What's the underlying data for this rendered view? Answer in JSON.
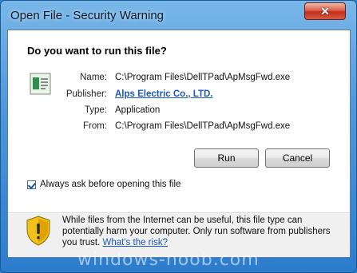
{
  "window": {
    "title": "Open File - Security Warning",
    "close_glyph": "✕"
  },
  "dialog": {
    "heading": "Do you want to run this file?",
    "fields": [
      {
        "label": "Name:",
        "value": "C:\\Program Files\\DellTPad\\ApMsgFwd.exe"
      },
      {
        "label": "Publisher:",
        "value": "Alps Electric Co., LTD."
      },
      {
        "label": "Type:",
        "value": "Application"
      },
      {
        "label": "From:",
        "value": "C:\\Program Files\\DellTPad\\ApMsgFwd.exe"
      }
    ],
    "run_label": "Run",
    "cancel_label": "Cancel",
    "checkbox_label": "Always ask before opening this file",
    "checkbox_checked": true,
    "warning_text": "While files from the Internet can be useful, this file type can potentially harm your computer. Only run software from publishers you trust.",
    "warning_link": "What's the risk?"
  },
  "icons": {
    "file": "application-file-icon",
    "shield": "security-shield-warning-icon",
    "close": "close-icon"
  },
  "colors": {
    "link": "#1a58b8",
    "frame": "#4f97d9",
    "close_button": "#c42e1a",
    "shield_yellow": "#f2c11a"
  },
  "watermark": "windows-noob.com"
}
